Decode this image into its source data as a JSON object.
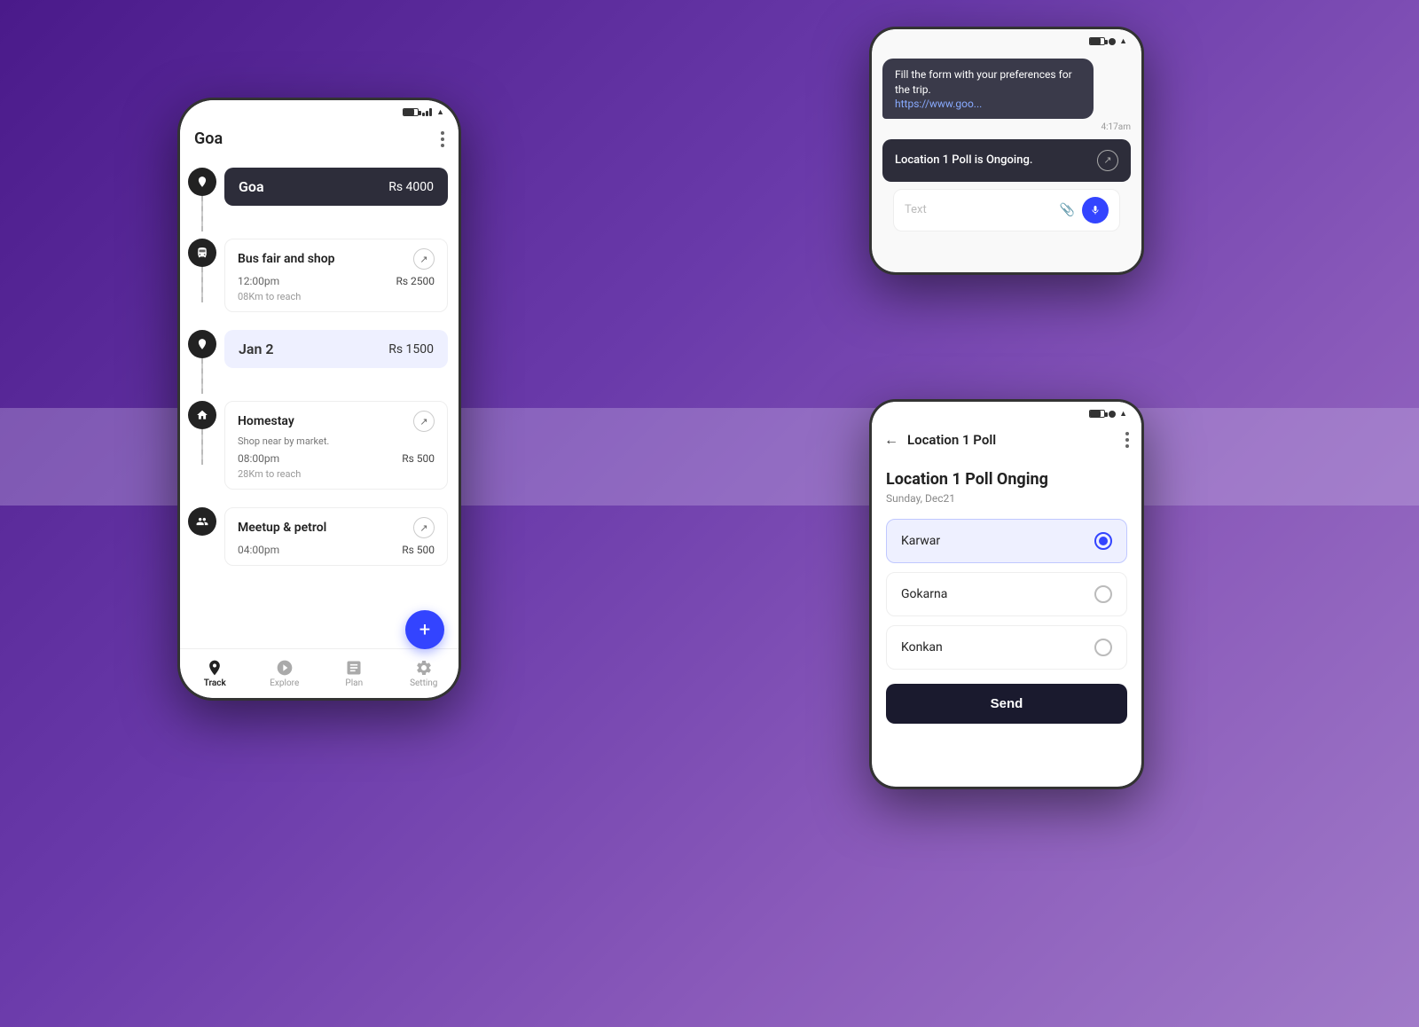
{
  "background": {
    "color": "#5a2a9a"
  },
  "phone1": {
    "title": "Goa",
    "destinations": [
      {
        "name": "Goa",
        "price": "Rs 4000",
        "style": "dark"
      },
      {
        "name": "Jan 2",
        "price": "Rs 1500",
        "style": "blue"
      }
    ],
    "activities": [
      {
        "name": "Bus fair and shop",
        "time": "12:00pm",
        "price": "Rs 2500",
        "dist": "08Km to reach"
      },
      {
        "name": "Homestay",
        "detail": "Shop near by market.",
        "time": "08:00pm",
        "price": "Rs 500",
        "dist": "28Km to reach"
      },
      {
        "name": "Meetup & petrol",
        "time": "04:00pm",
        "price": "Rs 500"
      }
    ],
    "nav": {
      "items": [
        {
          "label": "Track",
          "active": true
        },
        {
          "label": "Explore",
          "active": false
        },
        {
          "label": "Plan",
          "active": false
        },
        {
          "label": "Setting",
          "active": false
        }
      ],
      "fab_label": "+"
    }
  },
  "phone2": {
    "chat_message": "Fill the form with your preferences for the trip.",
    "chat_link": "https://www.goo...",
    "chat_time": "4:17am",
    "poll_ongoing": "Location 1 Poll is Ongoing.",
    "text_placeholder": "Text"
  },
  "phone3": {
    "header_title": "Location 1 Poll",
    "poll_main_title": "Location 1 Poll Onging",
    "poll_date": "Sunday, Dec21",
    "options": [
      {
        "label": "Karwar",
        "selected": true
      },
      {
        "label": "Gokarna",
        "selected": false
      },
      {
        "label": "Konkan",
        "selected": false
      }
    ],
    "send_label": "Send"
  }
}
